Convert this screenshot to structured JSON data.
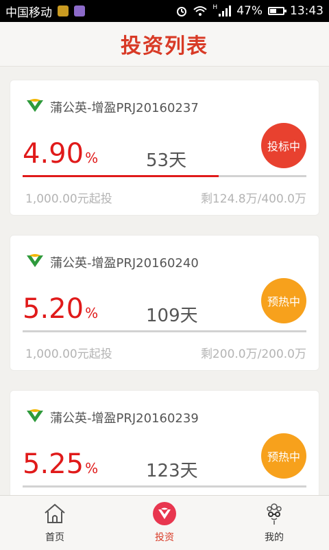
{
  "status_bar": {
    "carrier": "中国移动",
    "network": "H",
    "battery": "47%",
    "time": "13:43"
  },
  "header": {
    "title": "投资列表"
  },
  "colors": {
    "accent": "#d83a26",
    "rate": "#e01a1a",
    "badge_bidding": "#e8412f",
    "badge_preheat": "#f7a11c",
    "brand_green": "#2e9a3c"
  },
  "products": [
    {
      "name": "蒲公英-增盈PRJ20160237",
      "rate_value": "4.90",
      "rate_unit": "%",
      "term": "53天",
      "status": "投标中",
      "status_type": "bidding",
      "progress_percent": 69,
      "min_invest": "1,000.00元起投",
      "remaining": "剩124.8万/400.0万"
    },
    {
      "name": "蒲公英-增盈PRJ20160240",
      "rate_value": "5.20",
      "rate_unit": "%",
      "term": "109天",
      "status": "预热中",
      "status_type": "preheat",
      "progress_percent": 0,
      "min_invest": "1,000.00元起投",
      "remaining": "剩200.0万/200.0万"
    },
    {
      "name": "蒲公英-增盈PRJ20160239",
      "rate_value": "5.25",
      "rate_unit": "%",
      "term": "123天",
      "status": "预热中",
      "status_type": "preheat",
      "progress_percent": 0,
      "min_invest": "",
      "remaining": ""
    }
  ],
  "tabbar": {
    "home": {
      "label": "首页",
      "icon": "home-icon"
    },
    "invest": {
      "label": "投资",
      "icon": "invest-icon"
    },
    "mine": {
      "label": "我的",
      "icon": "profile-icon"
    }
  }
}
